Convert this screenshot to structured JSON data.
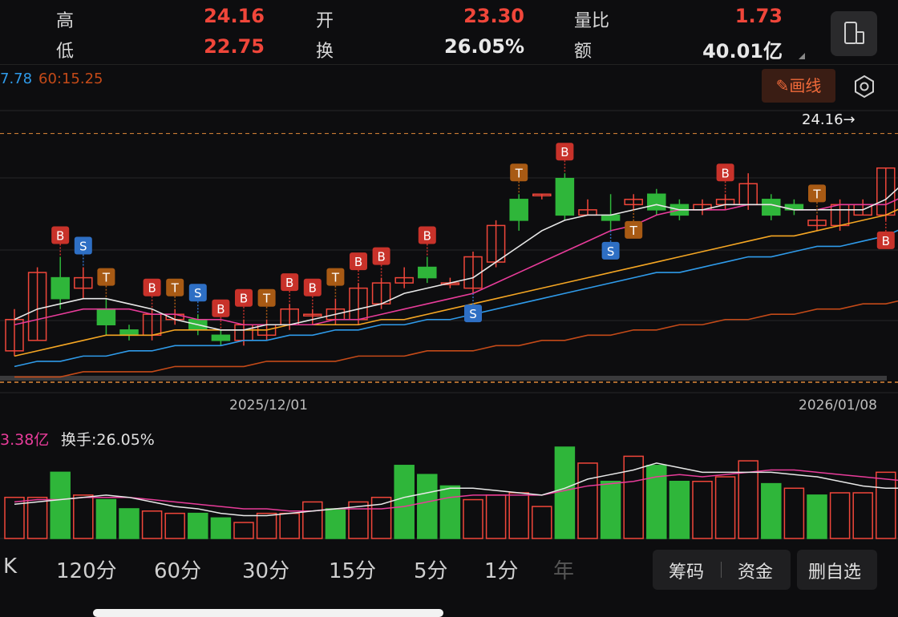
{
  "header": {
    "high_label": "高",
    "high_value": "24.16",
    "low_label": "低",
    "low_value": "22.75",
    "open_label": "开",
    "open_value": "23.30",
    "turnover_label": "换",
    "turnover_value": "26.05%",
    "volratio_label": "量比",
    "volratio_value": "1.73",
    "amount_label": "额",
    "amount_value": "40.01亿"
  },
  "ma_legend": {
    "ma_a": "7.78",
    "ma_b": "60:15.25"
  },
  "toolbar": {
    "draw_label": "画线"
  },
  "chart": {
    "price_high_marker": "24.16→",
    "date_left": "2025/12/01",
    "date_right": "2026/01/08",
    "volume_label": "3.38亿",
    "turnover_label": "换手:26.05%"
  },
  "periods": [
    "K",
    "120分",
    "60分",
    "30分",
    "15分",
    "5分",
    "1分",
    "年"
  ],
  "actions": {
    "chips": "筹码",
    "funds": "资金",
    "delete_watch": "删自选"
  },
  "colors": {
    "up": "#f0463a",
    "down": "#2fb63a",
    "ma5": "#e8e8e8",
    "ma10": "#e83c9a",
    "ma20": "#f5a623",
    "ma30": "#2f9bea",
    "ma60": "#c44a18"
  },
  "chart_data": {
    "type": "candlestick",
    "candles": [
      {
        "o": 20.0,
        "c": 20.6,
        "h": 20.8,
        "l": 19.9
      },
      {
        "o": 20.2,
        "c": 21.5,
        "h": 21.6,
        "l": 20.2
      },
      {
        "o": 21.4,
        "c": 21.0,
        "h": 21.8,
        "l": 20.8
      },
      {
        "o": 21.2,
        "c": 21.4,
        "h": 21.6,
        "l": 21.0
      },
      {
        "o": 20.8,
        "c": 20.5,
        "h": 21.0,
        "l": 20.3
      },
      {
        "o": 20.4,
        "c": 20.3,
        "h": 20.5,
        "l": 20.2
      },
      {
        "o": 20.3,
        "c": 20.7,
        "h": 20.8,
        "l": 20.2
      },
      {
        "o": 20.6,
        "c": 20.7,
        "h": 20.8,
        "l": 20.5
      },
      {
        "o": 20.6,
        "c": 20.4,
        "h": 20.7,
        "l": 20.3
      },
      {
        "o": 20.3,
        "c": 20.2,
        "h": 20.4,
        "l": 20.1
      },
      {
        "o": 20.2,
        "c": 20.5,
        "h": 20.6,
        "l": 20.1
      },
      {
        "o": 20.3,
        "c": 20.5,
        "h": 20.6,
        "l": 20.2
      },
      {
        "o": 20.5,
        "c": 20.8,
        "h": 20.9,
        "l": 20.4
      },
      {
        "o": 20.7,
        "c": 20.7,
        "h": 20.8,
        "l": 20.5
      },
      {
        "o": 20.6,
        "c": 20.8,
        "h": 21.0,
        "l": 20.5
      },
      {
        "o": 20.6,
        "c": 21.2,
        "h": 21.3,
        "l": 20.5
      },
      {
        "o": 20.9,
        "c": 21.3,
        "h": 21.4,
        "l": 20.8
      },
      {
        "o": 21.3,
        "c": 21.4,
        "h": 21.6,
        "l": 21.2
      },
      {
        "o": 21.6,
        "c": 21.4,
        "h": 21.8,
        "l": 21.3
      },
      {
        "o": 21.3,
        "c": 21.3,
        "h": 21.4,
        "l": 21.2
      },
      {
        "o": 21.2,
        "c": 21.8,
        "h": 21.9,
        "l": 21.1
      },
      {
        "o": 21.7,
        "c": 22.4,
        "h": 22.5,
        "l": 21.6
      },
      {
        "o": 22.9,
        "c": 22.5,
        "h": 23.0,
        "l": 22.3
      },
      {
        "o": 23.0,
        "c": 23.0,
        "h": 23.0,
        "l": 22.9
      },
      {
        "o": 23.3,
        "c": 22.6,
        "h": 23.4,
        "l": 22.5
      },
      {
        "o": 22.6,
        "c": 22.7,
        "h": 22.9,
        "l": 22.6
      },
      {
        "o": 22.6,
        "c": 22.5,
        "h": 23.0,
        "l": 22.3
      },
      {
        "o": 22.8,
        "c": 22.9,
        "h": 23.0,
        "l": 22.7
      },
      {
        "o": 23.0,
        "c": 22.7,
        "h": 23.1,
        "l": 22.6
      },
      {
        "o": 22.8,
        "c": 22.6,
        "h": 22.9,
        "l": 22.5
      },
      {
        "o": 22.7,
        "c": 22.8,
        "h": 22.9,
        "l": 22.6
      },
      {
        "o": 22.8,
        "c": 22.9,
        "h": 23.0,
        "l": 22.7
      },
      {
        "o": 22.8,
        "c": 23.2,
        "h": 23.4,
        "l": 22.7
      },
      {
        "o": 22.9,
        "c": 22.6,
        "h": 23.0,
        "l": 22.5
      },
      {
        "o": 22.8,
        "c": 22.7,
        "h": 22.9,
        "l": 22.6
      },
      {
        "o": 22.4,
        "c": 22.5,
        "h": 22.6,
        "l": 22.3
      },
      {
        "o": 22.4,
        "c": 22.8,
        "h": 22.9,
        "l": 22.3
      },
      {
        "o": 22.6,
        "c": 22.8,
        "h": 22.9,
        "l": 22.6
      },
      {
        "o": 22.6,
        "c": 23.5,
        "h": 23.5,
        "l": 22.5
      },
      {
        "o": 23.6,
        "c": 24.1,
        "h": 24.16,
        "l": 22.75
      }
    ],
    "volume": [
      {
        "v": 18,
        "up": true
      },
      {
        "v": 18,
        "up": true
      },
      {
        "v": 29,
        "up": false
      },
      {
        "v": 19,
        "up": true
      },
      {
        "v": 17,
        "up": false
      },
      {
        "v": 13,
        "up": false
      },
      {
        "v": 12,
        "up": true
      },
      {
        "v": 11,
        "up": true
      },
      {
        "v": 11,
        "up": false
      },
      {
        "v": 9,
        "up": false
      },
      {
        "v": 7,
        "up": true
      },
      {
        "v": 11,
        "up": true
      },
      {
        "v": 11,
        "up": true
      },
      {
        "v": 16,
        "up": true
      },
      {
        "v": 13,
        "up": false
      },
      {
        "v": 16,
        "up": true
      },
      {
        "v": 18,
        "up": true
      },
      {
        "v": 32,
        "up": false
      },
      {
        "v": 28,
        "up": false
      },
      {
        "v": 23,
        "up": false
      },
      {
        "v": 17,
        "up": true
      },
      {
        "v": 19,
        "up": true
      },
      {
        "v": 20,
        "up": true
      },
      {
        "v": 14,
        "up": true
      },
      {
        "v": 40,
        "up": false
      },
      {
        "v": 33,
        "up": true
      },
      {
        "v": 25,
        "up": false
      },
      {
        "v": 36,
        "up": true
      },
      {
        "v": 32,
        "up": false
      },
      {
        "v": 25,
        "up": false
      },
      {
        "v": 25,
        "up": true
      },
      {
        "v": 27,
        "up": true
      },
      {
        "v": 34,
        "up": true
      },
      {
        "v": 24,
        "up": false
      },
      {
        "v": 22,
        "up": true
      },
      {
        "v": 19,
        "up": false
      },
      {
        "v": 20,
        "up": true
      },
      {
        "v": 20,
        "up": true
      },
      {
        "v": 29,
        "up": true
      },
      {
        "v": 22,
        "up": true
      }
    ],
    "y_range": [
      19.2,
      24.6
    ],
    "high_line": 24.16,
    "low_line": 19.4,
    "markers": [
      {
        "i": 2,
        "t": "B",
        "side": "above"
      },
      {
        "i": 3,
        "t": "S",
        "side": "above"
      },
      {
        "i": 4,
        "t": "T",
        "side": "above"
      },
      {
        "i": 6,
        "t": "B",
        "side": "above"
      },
      {
        "i": 7,
        "t": "T",
        "side": "above"
      },
      {
        "i": 8,
        "t": "S",
        "side": "above"
      },
      {
        "i": 9,
        "t": "B",
        "side": "above"
      },
      {
        "i": 10,
        "t": "B",
        "side": "above"
      },
      {
        "i": 11,
        "t": "T",
        "side": "above"
      },
      {
        "i": 12,
        "t": "B",
        "side": "above"
      },
      {
        "i": 13,
        "t": "B",
        "side": "above"
      },
      {
        "i": 14,
        "t": "T",
        "side": "above"
      },
      {
        "i": 15,
        "t": "B",
        "side": "above"
      },
      {
        "i": 16,
        "t": "B",
        "side": "above"
      },
      {
        "i": 18,
        "t": "B",
        "side": "above"
      },
      {
        "i": 20,
        "t": "S",
        "side": "below"
      },
      {
        "i": 22,
        "t": "T",
        "side": "above"
      },
      {
        "i": 24,
        "t": "B",
        "side": "above"
      },
      {
        "i": 26,
        "t": "S",
        "side": "below"
      },
      {
        "i": 27,
        "t": "T",
        "side": "below"
      },
      {
        "i": 31,
        "t": "B",
        "side": "above"
      },
      {
        "i": 35,
        "t": "T",
        "side": "above"
      },
      {
        "i": 38,
        "t": "B",
        "side": "below"
      }
    ],
    "ma": {
      "ma5": [
        20.6,
        20.8,
        20.9,
        21.0,
        21.0,
        20.9,
        20.8,
        20.6,
        20.5,
        20.4,
        20.4,
        20.5,
        20.5,
        20.6,
        20.7,
        20.8,
        20.9,
        21.1,
        21.2,
        21.3,
        21.4,
        21.7,
        22.0,
        22.3,
        22.5,
        22.6,
        22.6,
        22.7,
        22.8,
        22.7,
        22.7,
        22.8,
        22.8,
        22.8,
        22.7,
        22.7,
        22.7,
        22.7,
        22.9,
        23.3
      ],
      "ma10": [
        20.5,
        20.6,
        20.7,
        20.8,
        20.8,
        20.8,
        20.7,
        20.7,
        20.6,
        20.6,
        20.5,
        20.5,
        20.5,
        20.5,
        20.6,
        20.6,
        20.7,
        20.8,
        20.9,
        21.0,
        21.1,
        21.3,
        21.5,
        21.7,
        21.9,
        22.1,
        22.3,
        22.4,
        22.6,
        22.7,
        22.7,
        22.7,
        22.8,
        22.8,
        22.7,
        22.7,
        22.8,
        22.8,
        22.8,
        23.0
      ],
      "ma20": [
        19.9,
        20.0,
        20.1,
        20.2,
        20.3,
        20.3,
        20.3,
        20.4,
        20.4,
        20.4,
        20.4,
        20.4,
        20.5,
        20.5,
        20.5,
        20.5,
        20.6,
        20.6,
        20.7,
        20.8,
        20.9,
        21.0,
        21.1,
        21.2,
        21.3,
        21.4,
        21.5,
        21.6,
        21.7,
        21.8,
        21.9,
        22.0,
        22.1,
        22.2,
        22.2,
        22.3,
        22.4,
        22.5,
        22.6,
        22.8
      ],
      "ma30": [
        19.7,
        19.8,
        19.8,
        19.9,
        19.9,
        20.0,
        20.0,
        20.1,
        20.1,
        20.1,
        20.2,
        20.2,
        20.3,
        20.3,
        20.4,
        20.4,
        20.5,
        20.5,
        20.6,
        20.6,
        20.7,
        20.8,
        20.9,
        21.0,
        21.1,
        21.2,
        21.3,
        21.4,
        21.5,
        21.5,
        21.6,
        21.7,
        21.8,
        21.8,
        21.9,
        22.0,
        22.0,
        22.1,
        22.2,
        22.4
      ],
      "ma60": [
        19.5,
        19.5,
        19.5,
        19.6,
        19.6,
        19.6,
        19.6,
        19.7,
        19.7,
        19.7,
        19.7,
        19.8,
        19.8,
        19.8,
        19.8,
        19.9,
        19.9,
        19.9,
        20.0,
        20.0,
        20.0,
        20.1,
        20.1,
        20.2,
        20.2,
        20.3,
        20.3,
        20.4,
        20.4,
        20.5,
        20.5,
        20.6,
        20.6,
        20.7,
        20.7,
        20.8,
        20.8,
        20.9,
        20.9,
        21.0
      ]
    },
    "vol_ma": {
      "a": [
        15,
        16,
        17,
        18,
        19,
        18,
        16,
        14,
        13,
        11,
        10,
        10,
        11,
        12,
        13,
        14,
        15,
        18,
        20,
        22,
        22,
        21,
        20,
        19,
        22,
        26,
        28,
        30,
        33,
        31,
        29,
        29,
        29,
        29,
        28,
        27,
        25,
        23,
        22,
        22
      ],
      "b": [
        16,
        17,
        17,
        18,
        18,
        18,
        17,
        16,
        15,
        14,
        13,
        13,
        12,
        12,
        13,
        13,
        13,
        14,
        16,
        18,
        19,
        19,
        19,
        19,
        21,
        23,
        24,
        25,
        27,
        28,
        27,
        28,
        29,
        30,
        30,
        29,
        28,
        27,
        26,
        25
      ]
    }
  }
}
